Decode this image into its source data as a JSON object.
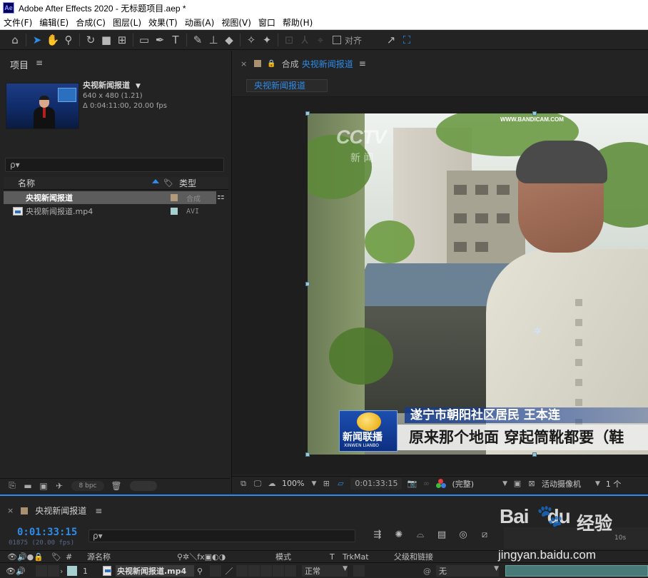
{
  "window": {
    "title": "Adobe After Effects 2020 - 无标题项目.aep *",
    "logo": "Ae"
  },
  "menu": [
    "文件(F)",
    "编辑(E)",
    "合成(C)",
    "图层(L)",
    "效果(T)",
    "动画(A)",
    "视图(V)",
    "窗口",
    "帮助(H)"
  ],
  "toolbar": {
    "snap_label": "对齐"
  },
  "project": {
    "title": "项目",
    "preview": {
      "name": "央视新闻报道",
      "resolution": "640 x 480 (1.21)",
      "duration": "Δ 0:04:11:00, 20.00 fps"
    },
    "search_placeholder": "ρ▾",
    "columns": {
      "name": "名称",
      "type": "类型"
    },
    "items": [
      {
        "name": "央视新闻报道",
        "type": "合成",
        "label_color": "#b39a7a",
        "kind": "comp"
      },
      {
        "name": "央视新闻报道.mp4",
        "type": "AVI",
        "label_color": "#a6cfd0",
        "kind": "footage"
      }
    ],
    "bpc": "8 bpc"
  },
  "composition": {
    "panel_label": "合成",
    "name": "央视新闻报道",
    "subtab": "央视新闻报道",
    "frame": {
      "watermark": "WWW.BANDICAM.COM",
      "channel_logo": "CCTV",
      "channel_sub": "新 闻",
      "news_logo": "新闻联播",
      "news_logo_pinyin": "XINWEN LIANBO",
      "caption_name": "遂宁市朝阳社区居民 王本连",
      "caption_text": "原来那个地面  穿起筒靴都要（鞋"
    },
    "zoom": "100%",
    "timecode": "0:01:33:15",
    "resolution": "(完整)",
    "camera": "活动摄像机",
    "views": "1 个"
  },
  "timeline": {
    "comp_name": "央视新闻报道",
    "timecode": "0:01:33:15",
    "frames_fps": "01875 (20.00 fps)",
    "search_placeholder": "ρ▾",
    "columns": {
      "num": "#",
      "source": "源名称",
      "mode": "模式",
      "t": "T",
      "trkmat": "TrkMat",
      "parent": "父级和链接"
    },
    "ruler_tick": "10s",
    "layers": [
      {
        "num": "1",
        "name": "央视新闻报道.mp4",
        "mode": "正常",
        "parent": "无",
        "color": "#a6cfd0"
      }
    ]
  },
  "site_watermark": {
    "logo": "Bai",
    "logo2": "du",
    "cn": "经验",
    "url": "jingyan.baidu.com"
  }
}
